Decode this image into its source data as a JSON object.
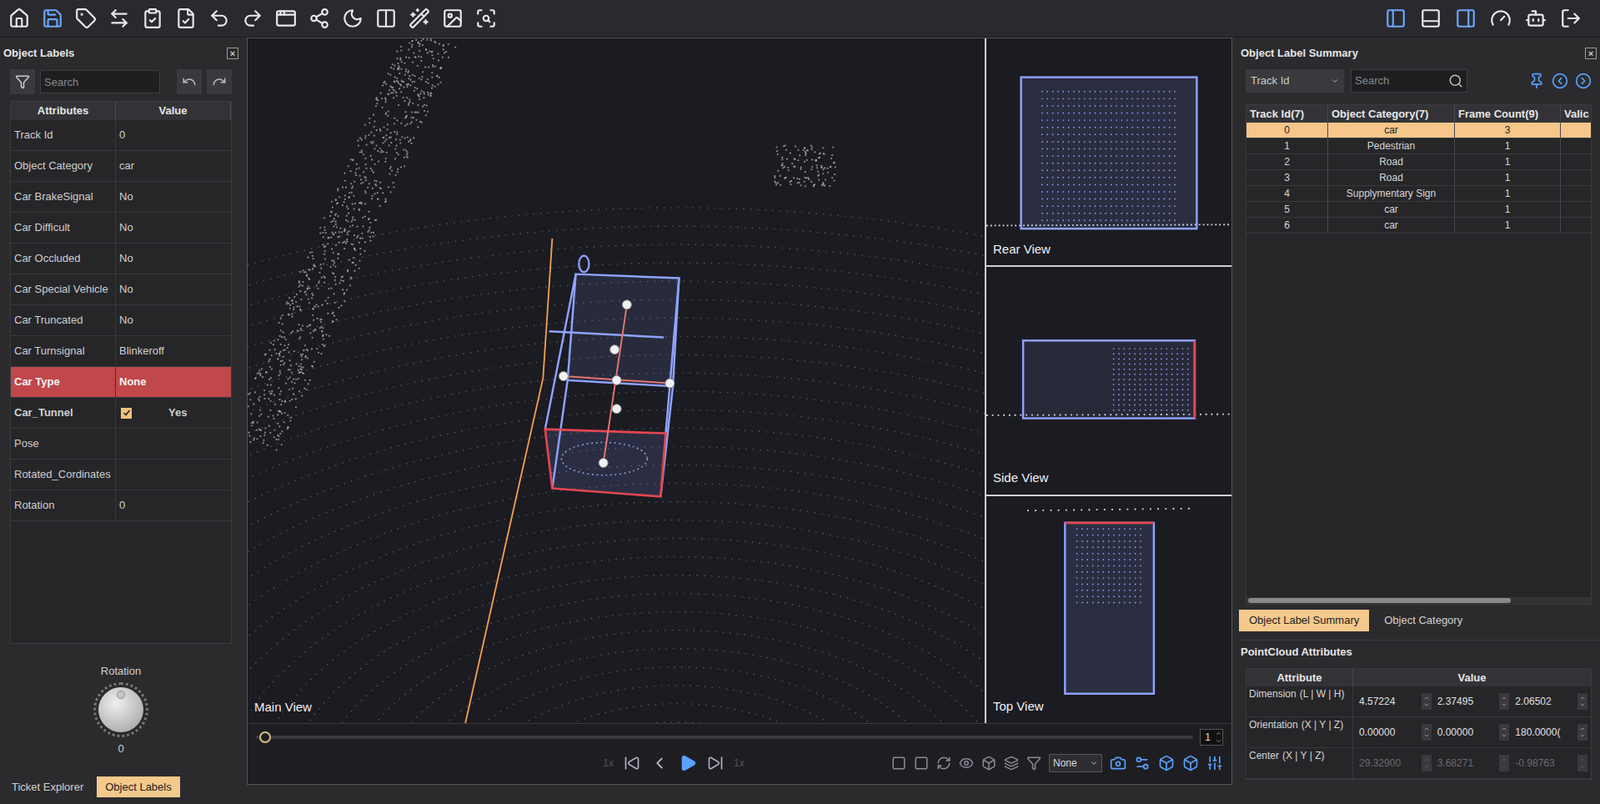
{
  "leftPanel": {
    "title": "Object Labels",
    "close": "×",
    "search": {
      "placeholder": "Search"
    },
    "columns": [
      "Attributes",
      "Value"
    ],
    "rows": [
      {
        "name": "Track Id",
        "value": "0",
        "kind": "text",
        "selected": false,
        "bold": false
      },
      {
        "name": "Object Category",
        "value": "car",
        "kind": "text",
        "selected": false,
        "bold": false
      },
      {
        "name": "Car BrakeSignal",
        "value": "No",
        "kind": "text",
        "selected": false,
        "bold": false
      },
      {
        "name": "Car Difficult",
        "value": "No",
        "kind": "text",
        "selected": false,
        "bold": false
      },
      {
        "name": "Car Occluded",
        "value": "No",
        "kind": "text",
        "selected": false,
        "bold": false
      },
      {
        "name": "Car Special Vehicle",
        "value": "No",
        "kind": "text",
        "selected": false,
        "bold": false
      },
      {
        "name": "Car Truncated",
        "value": "No",
        "kind": "text",
        "selected": false,
        "bold": false
      },
      {
        "name": "Car Turnsignal",
        "value": "Blinkeroff",
        "kind": "text",
        "selected": false,
        "bold": false
      },
      {
        "name": "Car Type",
        "value": "None",
        "kind": "text",
        "selected": true,
        "bold": true
      },
      {
        "name": "Car_Tunnel",
        "value": "Yes",
        "kind": "checkbox",
        "checked": true,
        "selected": false,
        "bold": true
      },
      {
        "name": "Pose",
        "value": "",
        "kind": "text",
        "selected": false,
        "bold": false
      },
      {
        "name": "Rotated_Cordinates",
        "value": "",
        "kind": "text",
        "selected": false,
        "bold": false
      },
      {
        "name": "Rotation",
        "value": "0",
        "kind": "text",
        "selected": false,
        "bold": false
      }
    ],
    "rotation": {
      "label": "Rotation",
      "value": "0"
    },
    "tabs": [
      {
        "label": "Ticket Explorer",
        "selected": false
      },
      {
        "label": "Object Labels",
        "selected": true
      }
    ]
  },
  "views": {
    "main": "Main View",
    "rear": "Rear View",
    "side": "Side View",
    "top": "Top View"
  },
  "timeline": {
    "level": 0,
    "frame": "1",
    "speedLeft": "1x",
    "speedRight": "1x",
    "mode": "None"
  },
  "rightPanel": {
    "title": "Object Label Summary",
    "close": "×",
    "filter": "Track Id",
    "search": {
      "placeholder": "Search"
    },
    "columns": [
      "Track Id(7)",
      "Object Category(7)",
      "Frame Count(9)",
      "Valic"
    ],
    "rows": [
      {
        "id": "0",
        "category": "car",
        "count": "3",
        "selected": true
      },
      {
        "id": "1",
        "category": "Pedestrian",
        "count": "1",
        "selected": false
      },
      {
        "id": "2",
        "category": "Road",
        "count": "1",
        "selected": false
      },
      {
        "id": "3",
        "category": "Road",
        "count": "1",
        "selected": false
      },
      {
        "id": "4",
        "category": "Supplymentary Sign",
        "count": "1",
        "selected": false
      },
      {
        "id": "5",
        "category": "car",
        "count": "1",
        "selected": false
      },
      {
        "id": "6",
        "category": "car",
        "count": "1",
        "selected": false
      }
    ],
    "tabs": [
      {
        "label": "Object Label Summary",
        "selected": true
      },
      {
        "label": "Object Category",
        "selected": false
      }
    ],
    "attributes": {
      "title": "PointCloud Attributes",
      "columns": [
        "Attribute",
        "Value"
      ],
      "rows": [
        {
          "name": "Dimension",
          "axes": "(L | W | H)",
          "values": [
            "4.57224",
            "2.37495",
            "2.06502"
          ],
          "disabled": false
        },
        {
          "name": "Orientation",
          "axes": "(X | Y | Z)",
          "values": [
            "0.00000",
            "0.00000",
            "180.0000("
          ],
          "disabled": false
        },
        {
          "name": "Center",
          "axes": "(X | Y | Z)",
          "values": [
            "29.32900",
            "3.68271",
            "-0.98763"
          ],
          "disabled": true
        }
      ]
    }
  }
}
